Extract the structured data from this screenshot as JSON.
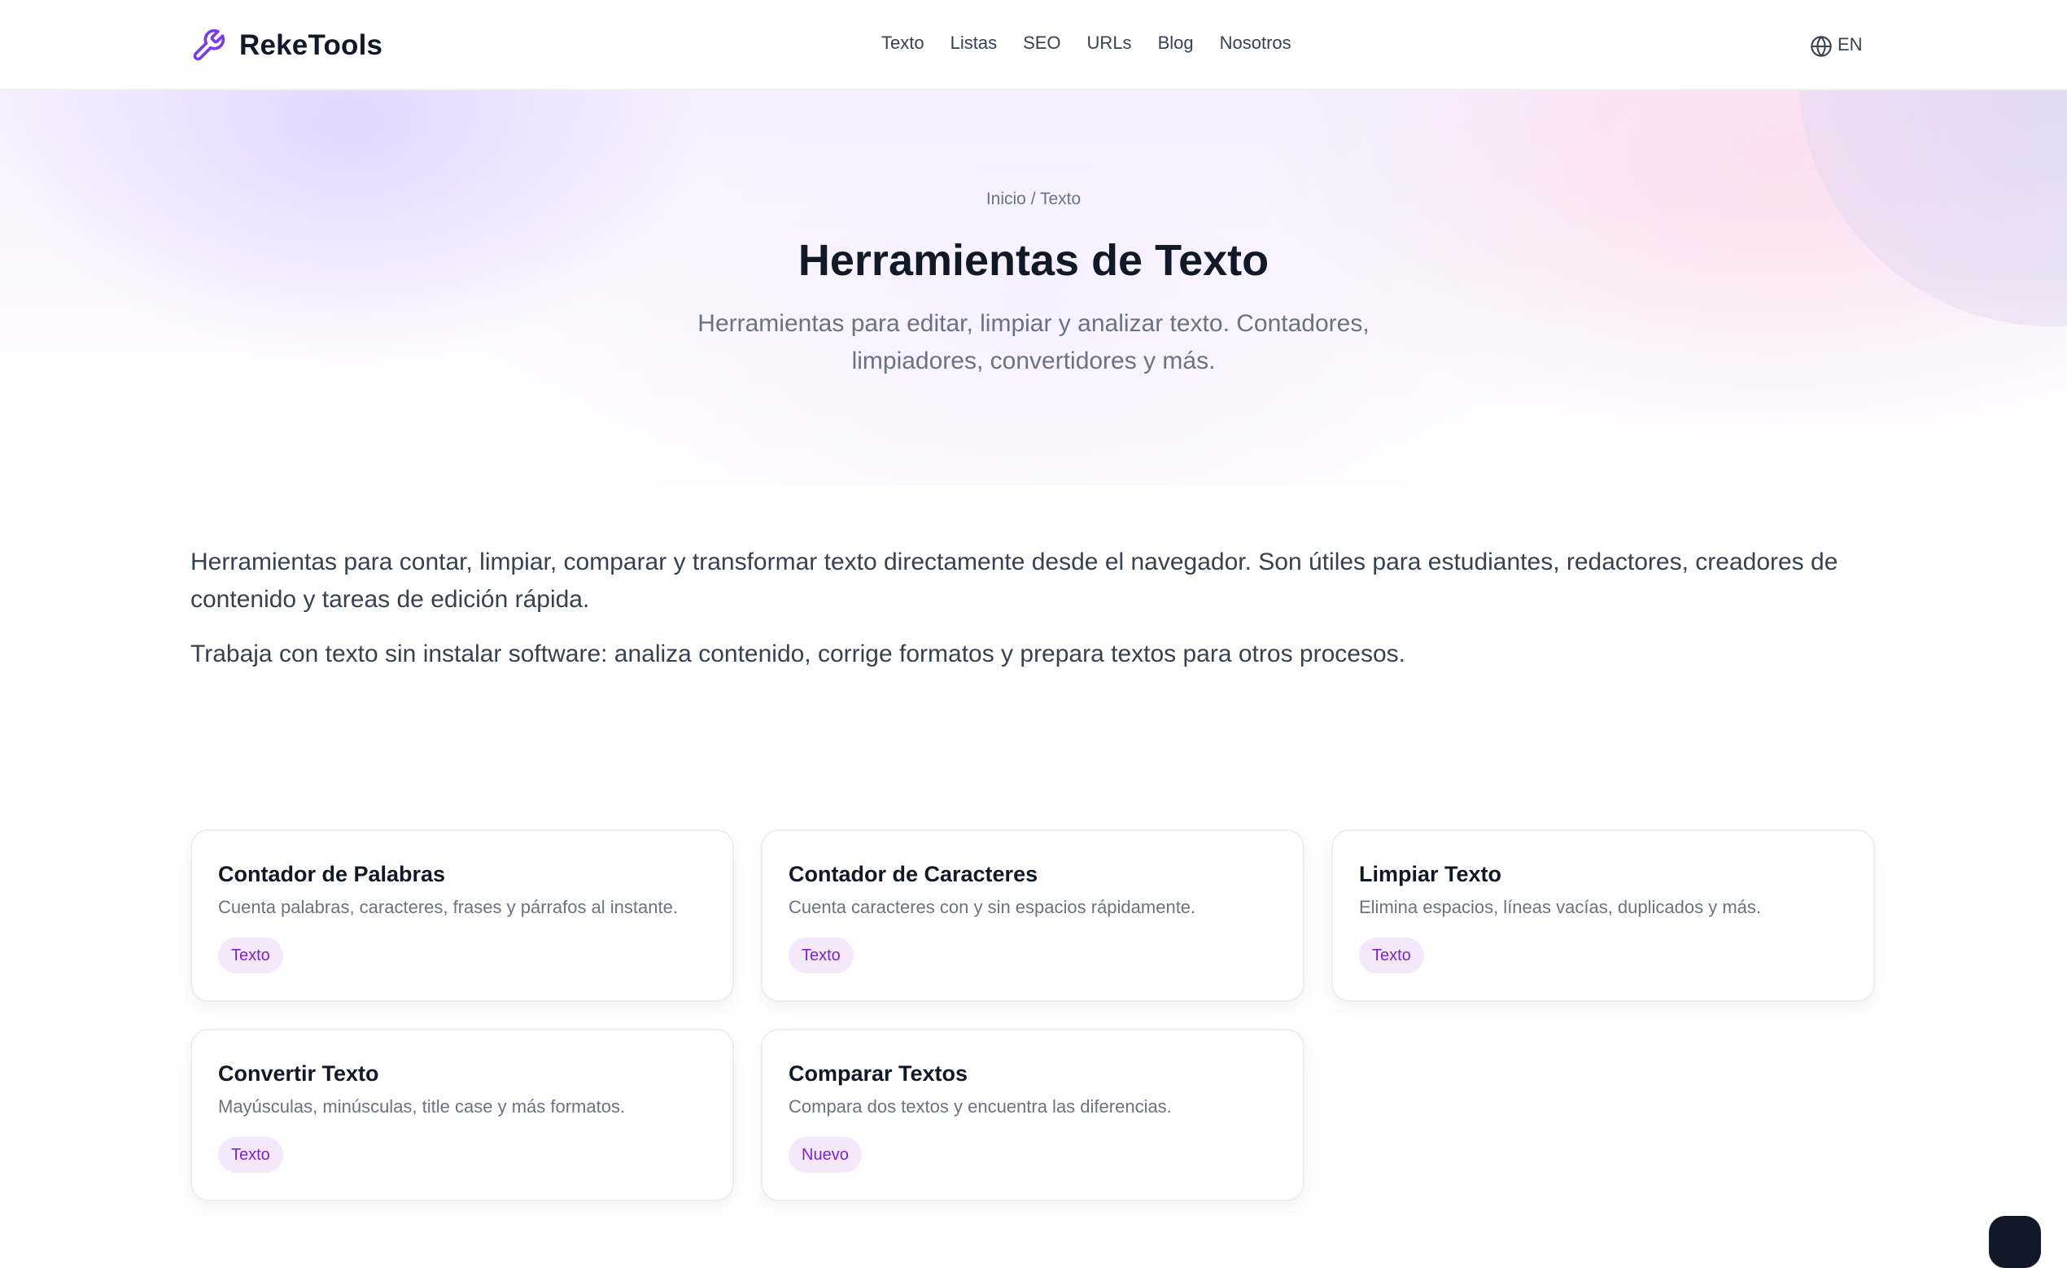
{
  "header": {
    "logo_text": "RekeTools",
    "logo_icon": "wrench-icon",
    "nav": [
      {
        "label": "Texto"
      },
      {
        "label": "Listas"
      },
      {
        "label": "SEO"
      },
      {
        "label": "URLs"
      },
      {
        "label": "Blog"
      },
      {
        "label": "Nosotros"
      }
    ],
    "language_icon": "globe-icon",
    "language_label": "EN"
  },
  "hero": {
    "breadcrumb": {
      "home": "Inicio",
      "separator": "/",
      "current": "Texto"
    },
    "title": "Herramientas de Texto",
    "subtitle": "Herramientas para editar, limpiar y analizar texto. Contadores, limpiadores, convertidores y más."
  },
  "intro": {
    "paragraph_1": "Herramientas para contar, limpiar, comparar y transformar texto directamente desde el navegador. Son útiles para estudiantes, redactores, creadores de contenido y tareas de edición rápida.",
    "paragraph_2": "Trabaja con texto sin instalar software: analiza contenido, corrige formatos y prepara textos para otros procesos."
  },
  "tools": [
    {
      "title": "Contador de Palabras",
      "description": "Cuenta palabras, caracteres, frases y párrafos al instante.",
      "badge": "Texto"
    },
    {
      "title": "Contador de Caracteres",
      "description": "Cuenta caracteres con y sin espacios rápidamente.",
      "badge": "Texto"
    },
    {
      "title": "Limpiar Texto",
      "description": "Elimina espacios, líneas vacías, duplicados y más.",
      "badge": "Texto"
    },
    {
      "title": "Convertir Texto",
      "description": "Mayúsculas, minúsculas, title case y más formatos.",
      "badge": "Texto"
    },
    {
      "title": "Comparar Textos",
      "description": "Compara dos textos y encuentra las diferencias.",
      "badge": "Nuevo"
    }
  ],
  "colors": {
    "accent": "#7e22ce",
    "badge_bg": "#f5e8fb",
    "text_primary": "#111827",
    "text_muted": "#6b7280"
  }
}
